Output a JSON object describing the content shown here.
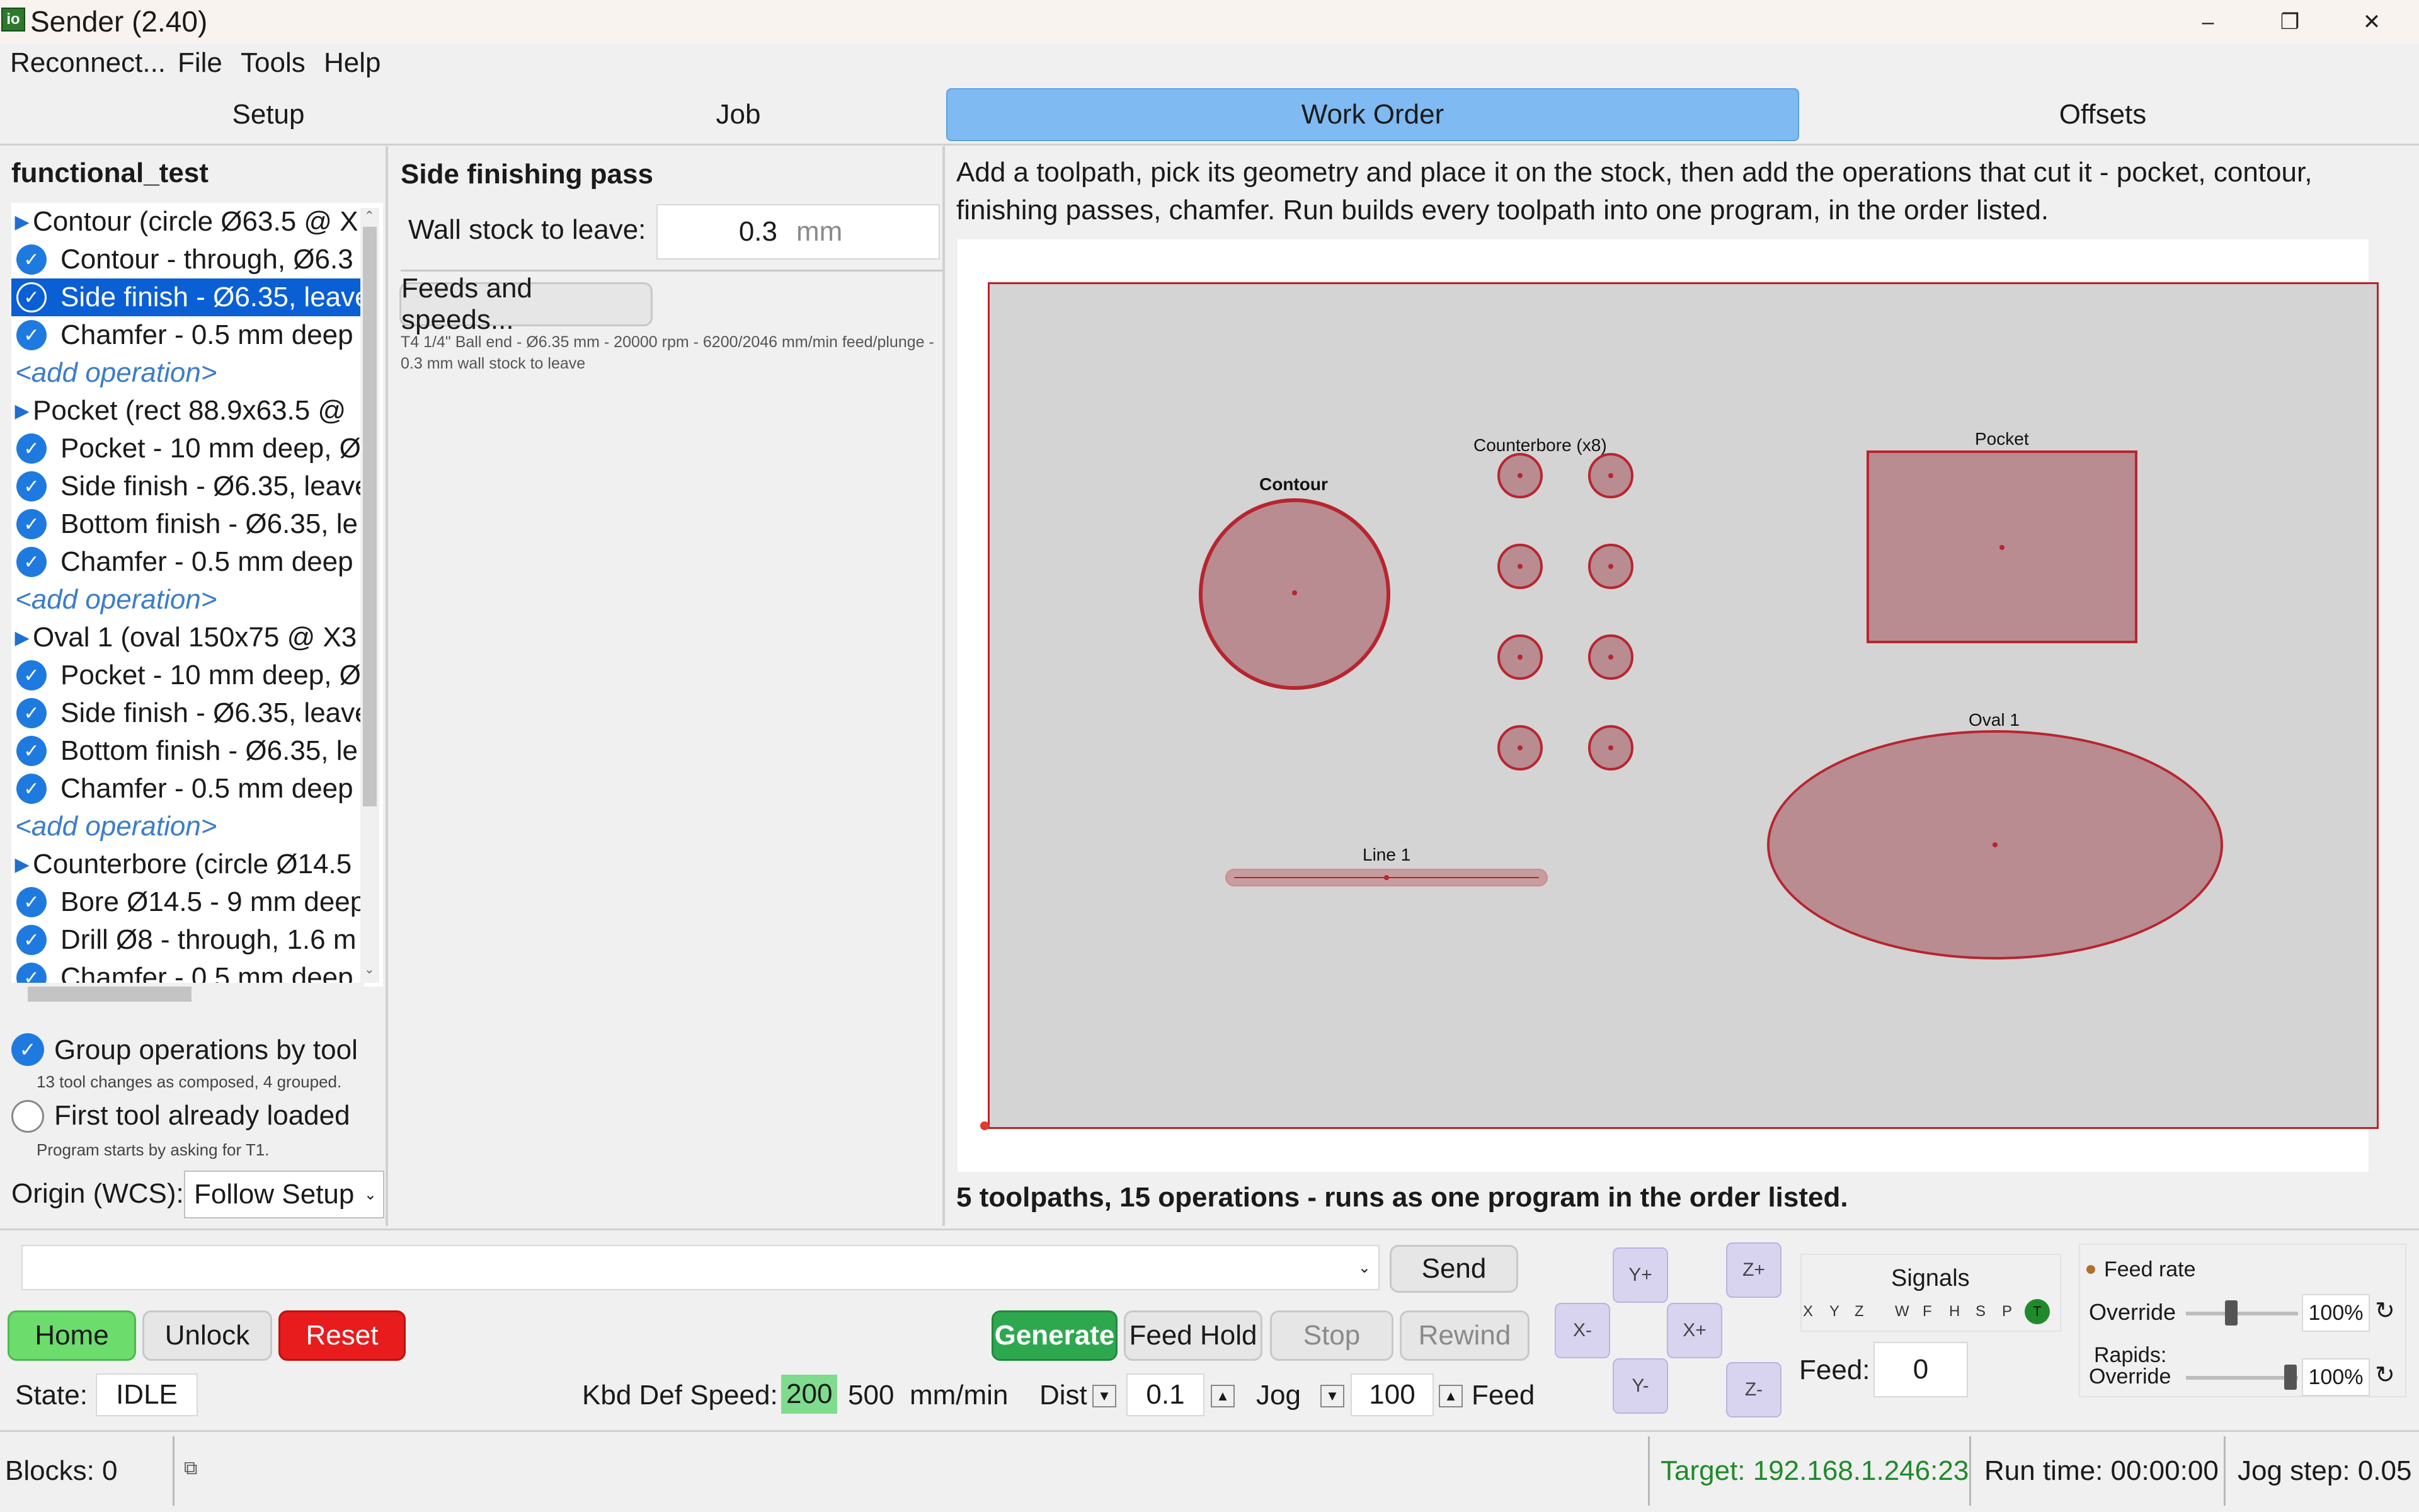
{
  "window": {
    "title": "Sender (2.40)",
    "icon_text": "io",
    "minimize": "–",
    "restore": "❐",
    "close": "✕"
  },
  "menu": [
    "Reconnect...",
    "File",
    "Tools",
    "Help"
  ],
  "tabs": [
    "Setup",
    "Job",
    "Work Order",
    "Offsets"
  ],
  "active_tab": "Work Order",
  "left": {
    "job_name": "functional_test",
    "tree": [
      {
        "type": "toolpath",
        "label": "Contour  (circle Ø63.5 @ X"
      },
      {
        "type": "op",
        "label": "Contour - through, Ø6.3"
      },
      {
        "type": "op",
        "label": "Side finish - Ø6.35, leave",
        "selected": true
      },
      {
        "type": "op",
        "label": "Chamfer - 0.5 mm deep"
      },
      {
        "type": "add",
        "label": "<add operation>"
      },
      {
        "type": "toolpath",
        "label": "Pocket  (rect 88.9x63.5 @"
      },
      {
        "type": "op",
        "label": "Pocket - 10 mm deep, Ø"
      },
      {
        "type": "op",
        "label": "Side finish - Ø6.35, leave"
      },
      {
        "type": "op",
        "label": "Bottom finish - Ø6.35, le"
      },
      {
        "type": "op",
        "label": "Chamfer - 0.5 mm deep"
      },
      {
        "type": "add",
        "label": "<add operation>"
      },
      {
        "type": "toolpath",
        "label": "Oval 1  (oval 150x75 @ X3"
      },
      {
        "type": "op",
        "label": "Pocket - 10 mm deep, Ø"
      },
      {
        "type": "op",
        "label": "Side finish - Ø6.35, leave"
      },
      {
        "type": "op",
        "label": "Bottom finish - Ø6.35, le"
      },
      {
        "type": "op",
        "label": "Chamfer - 0.5 mm deep"
      },
      {
        "type": "add",
        "label": "<add operation>"
      },
      {
        "type": "toolpath",
        "label": "Counterbore  (circle Ø14.5"
      },
      {
        "type": "op",
        "label": "Bore Ø14.5 - 9 mm deep"
      },
      {
        "type": "op",
        "label": "Drill Ø8 - through, 1.6 m"
      },
      {
        "type": "op",
        "label": "Chamfer - 0.5 mm deep"
      }
    ],
    "group_by_tool": {
      "label": "Group operations by tool",
      "checked": true,
      "note": "13 tool changes as composed, 4 grouped."
    },
    "first_tool_loaded": {
      "label": "First tool already loaded",
      "checked": false,
      "note": "Program starts by asking for T1."
    },
    "origin": {
      "label": "Origin (WCS):",
      "value": "Follow Setup"
    }
  },
  "middle": {
    "heading": "Side finishing pass",
    "wall_stock": {
      "label": "Wall stock to leave:",
      "value": "0.3",
      "unit": "mm"
    },
    "feeds_button": "Feeds and speeds...",
    "tool_summary": "T4 1/4\" Ball end - Ø6.35 mm - 20000 rpm - 6200/2046 mm/min feed/plunge - 0.3 mm wall stock to leave"
  },
  "right": {
    "instructions": "Add a toolpath, pick its geometry and place it on the stock, then add the operations that cut it - pocket, contour, finishing passes, chamfer. Run builds every toolpath into one program, in the order listed.",
    "labels": {
      "contour": "Contour",
      "counterbore": "Counterbore (x8)",
      "pocket": "Pocket",
      "oval": "Oval 1",
      "line": "Line 1"
    },
    "summary": "5 toolpaths, 15 operations - runs as one program in the order listed."
  },
  "controls": {
    "command_value": "",
    "send": "Send",
    "home": "Home",
    "unlock": "Unlock",
    "reset": "Reset",
    "generate": "Generate",
    "feed_hold": "Feed Hold",
    "stop": "Stop",
    "rewind": "Rewind",
    "state_label": "State:",
    "state_value": "IDLE",
    "kbd_label": "Kbd Def Speed:",
    "kbd_speed_1": "200",
    "kbd_speed_2": "500",
    "kbd_unit": "mm/min",
    "dist_label": "Dist",
    "dist_value": "0.1",
    "jog_label": "Jog",
    "jog_value": "100",
    "feed_label": "Feed",
    "jog": {
      "y_plus": "Y+",
      "y_minus": "Y-",
      "x_minus": "X-",
      "x_plus": "X+",
      "z_plus": "Z+",
      "z_minus": "Z-"
    },
    "signals": {
      "title": "Signals",
      "axes": [
        "X",
        "Y",
        "Z"
      ],
      "pins": [
        "W",
        "F",
        "H",
        "S",
        "P"
      ],
      "t": "T"
    },
    "feed": {
      "label": "Feed:",
      "value": "0"
    },
    "feed_rate": {
      "title": "Feed rate",
      "override_label": "Override",
      "override_value": "100%",
      "rapids_label_1": "Rapids:",
      "rapids_label_2": "Override",
      "rapids_value": "100%"
    }
  },
  "status": {
    "blocks": "Blocks: 0",
    "target": "Target: 192.168.1.246:23",
    "runtime": "Run time: 00:00:00",
    "jogstep": "Jog step: 0.05"
  },
  "colors": {
    "accent": "#7fbbf2",
    "selection": "#0a5fd4",
    "home_green": "#6cdc6c",
    "reset_red": "#e81c1c",
    "generate_green": "#2ea84f",
    "shape_stroke": "#b8252f",
    "target_green": "#1f8a2a"
  }
}
